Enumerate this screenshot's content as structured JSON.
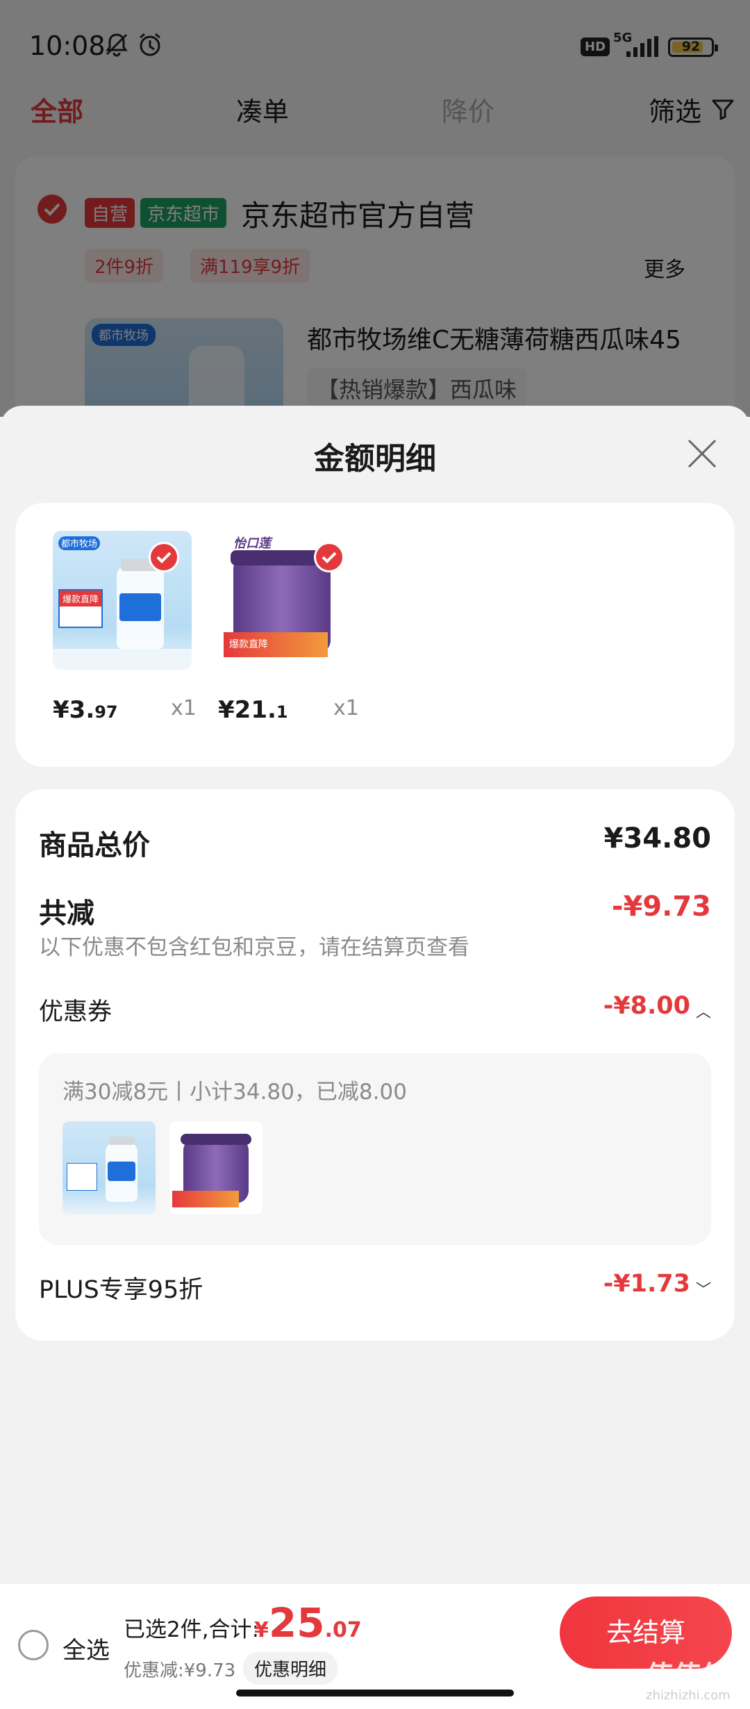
{
  "status_bar": {
    "time": "10:08",
    "network": "5G",
    "hd": "HD",
    "battery": "92"
  },
  "tabs": {
    "all": "全部",
    "bundle": "凑单",
    "price_drop": "降价",
    "filter": "筛选"
  },
  "store": {
    "self_tag": "自营",
    "jd_tag": "京东超市",
    "name": "京东超市官方自营",
    "promo1": "2件9折",
    "promo2": "满119享9折",
    "more": "更多",
    "product_title": "都市牧场维C无糖薄荷糖西瓜味45",
    "product_spec": "【热销爆款】西瓜味"
  },
  "sheet": {
    "title": "金额明细",
    "items": [
      {
        "price_int": "¥3.",
        "price_dec": "97",
        "qty": "x1",
        "brand": "都市牧场",
        "badge": "爆款直降"
      },
      {
        "price_int": "¥21.",
        "price_dec": "1",
        "qty": "x1",
        "brand": "怡口莲",
        "badge": "爆款直降"
      }
    ],
    "goods_total_label": "商品总价",
    "goods_total_value": "¥34.80",
    "reduce_label": "共减",
    "reduce_value": "-¥9.73",
    "hint": "以下优惠不包含红包和京豆，请在结算页查看",
    "coupon_label": "优惠券",
    "coupon_value": "-¥8.00",
    "coupon_desc": "满30减8元丨小计34.80，已减8.00",
    "plus_label": "PLUS专享95折",
    "plus_value": "-¥1.73"
  },
  "bottom": {
    "select_all": "全选",
    "selected": "已选2件,合计:",
    "total_currency": "¥",
    "total_int": "25",
    "total_dec": ".07",
    "discount": "优惠减:¥9.73",
    "detail_chip": "优惠明细",
    "checkout": "去结算"
  },
  "watermark": {
    "main": "值值值",
    "sub": "zhizhizhi.com"
  },
  "colors": {
    "accent": "#e4393c",
    "jd_green": "#1fa060",
    "background": "#f2f2f2"
  }
}
